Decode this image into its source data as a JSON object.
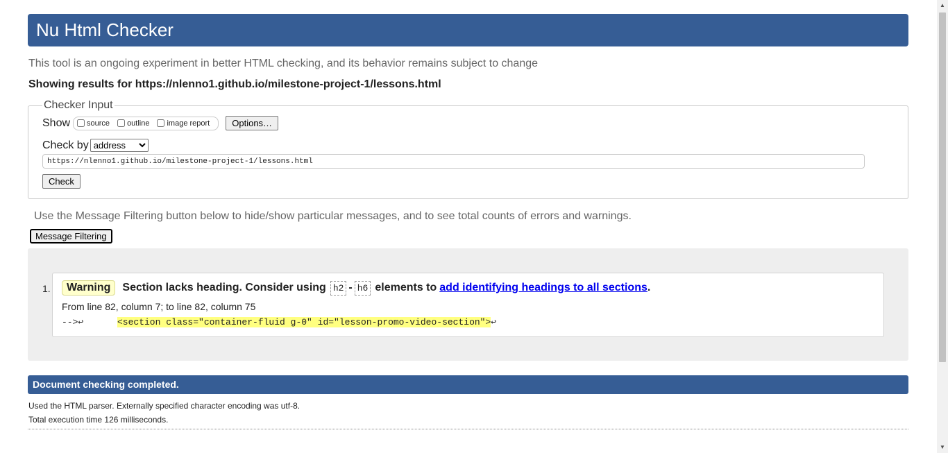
{
  "header": {
    "title": "Nu Html Checker"
  },
  "intro": "This tool is an ongoing experiment in better HTML checking, and its behavior remains subject to change",
  "showing": "Showing results for https://nlenno1.github.io/milestone-project-1/lessons.html",
  "checker": {
    "legend": "Checker Input",
    "show_label": "Show",
    "show_options": [
      "source",
      "outline",
      "image report"
    ],
    "options_button": "Options…",
    "check_by_label": "Check by",
    "check_by_value": "address",
    "url_value": "https://nlenno1.github.io/milestone-project-1/lessons.html",
    "check_button": "Check"
  },
  "filter": {
    "note": "Use the Message Filtering button below to hide/show particular messages, and to see total counts of errors and warnings.",
    "button": "Message Filtering"
  },
  "messages": [
    {
      "number": "1.",
      "type": "Warning",
      "text": "Section lacks heading. Consider using",
      "tag1": "h2",
      "dash": "-",
      "tag2": "h6",
      "text2": "elements to",
      "link": "add identifying headings to all sections",
      "end": ".",
      "location": "From line 82, column 7; to line 82, column 75",
      "extract_pre": "-->↩",
      "extract_highlight": "<section class=\"container-fluid g-0\" id=\"lesson-promo-video-section\">",
      "extract_post": "↩"
    }
  ],
  "completed": "Document checking completed.",
  "info": [
    "Used the HTML parser. Externally specified character encoding was utf-8.",
    "Total execution time 126 milliseconds."
  ],
  "colors": {
    "header_bg": "#365d95",
    "warning_bg": "#ffffcc",
    "highlight": "#ffff80"
  }
}
